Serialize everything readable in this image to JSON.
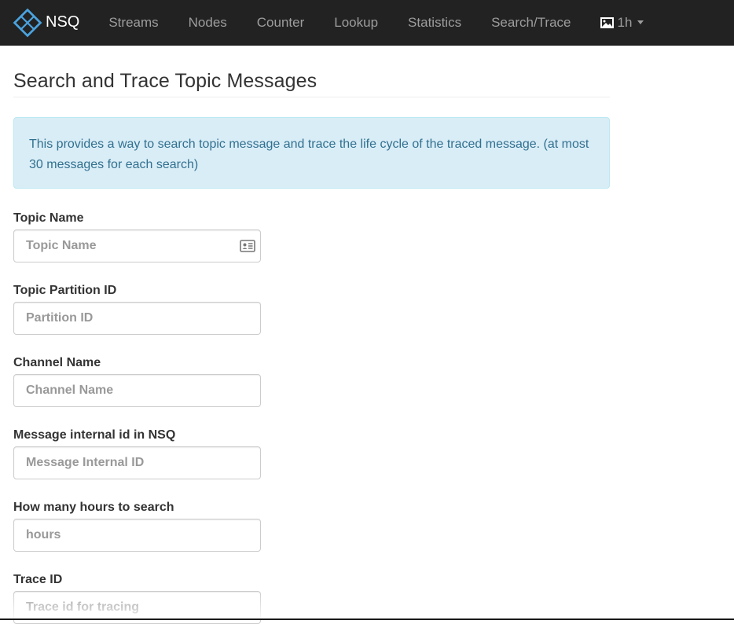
{
  "navbar": {
    "brand": "NSQ",
    "links": [
      "Streams",
      "Nodes",
      "Counter",
      "Lookup",
      "Statistics",
      "Search/Trace"
    ],
    "timeframe": "1h",
    "colors": {
      "background": "#222222",
      "link": "#9d9d9d",
      "brand_logo": "#4aa3df"
    }
  },
  "page": {
    "title": "Search and Trace Topic Messages",
    "info": "This provides a way to search topic message and trace the life cycle of the traced message. (at most 30 messages for each search)"
  },
  "form": {
    "topic_name": {
      "label": "Topic Name",
      "placeholder": "Topic Name",
      "value": "",
      "icon": "contact-card-icon"
    },
    "partition_id": {
      "label": "Topic Partition ID",
      "placeholder": "Partition ID",
      "value": ""
    },
    "channel_name": {
      "label": "Channel Name",
      "placeholder": "Channel Name",
      "value": ""
    },
    "message_id": {
      "label": "Message internal id in NSQ",
      "placeholder": "Message Internal ID",
      "value": ""
    },
    "hours": {
      "label": "How many hours to search",
      "placeholder": "hours",
      "value": ""
    },
    "trace_id": {
      "label": "Trace ID",
      "placeholder": "Trace id for tracing",
      "value": ""
    }
  }
}
